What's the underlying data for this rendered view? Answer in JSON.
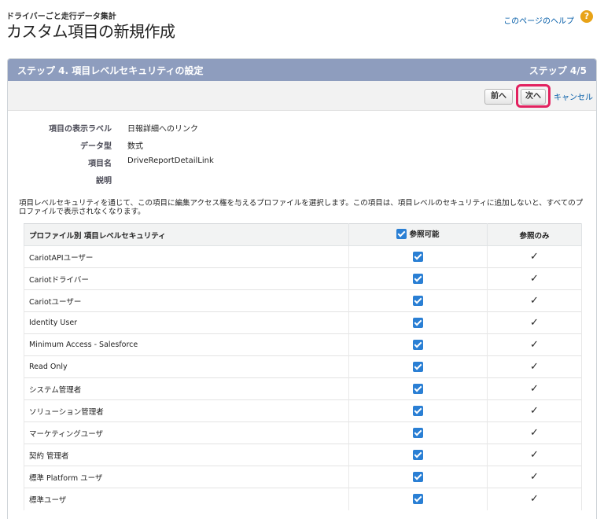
{
  "header": {
    "breadcrumb": "ドライバーごと走行データ集計",
    "title": "カスタム項目の新規作成",
    "help_link": "このページのヘルプ",
    "help_icon": "?"
  },
  "panel": {
    "title": "ステップ 4. 項目レベルセキュリティの設定",
    "step": "ステップ 4/5"
  },
  "buttons": {
    "prev": "前へ",
    "next": "次へ",
    "cancel": "キャンセル"
  },
  "details": [
    {
      "label": "項目の表示ラベル",
      "value": "日報詳細へのリンク"
    },
    {
      "label": "データ型",
      "value": "数式"
    },
    {
      "label": "項目名",
      "value": "DriveReportDetailLink"
    },
    {
      "label": "説明",
      "value": ""
    }
  ],
  "instructions": "項目レベルセキュリティを通じて、この項目に編集アクセス権を与えるプロファイルを選択します。この項目は、項目レベルのセキュリティに追加しないと、すべてのプロファイルで表示されなくなります。",
  "table": {
    "headers": {
      "profile": "プロファイル別 項目レベルセキュリティ",
      "visible": "参照可能",
      "readonly": "参照のみ"
    },
    "rows": [
      {
        "profile": "CariotAPIユーザー",
        "visible": true,
        "readonly": "✓"
      },
      {
        "profile": "Cariotドライバー",
        "visible": true,
        "readonly": "✓"
      },
      {
        "profile": "Cariotユーザー",
        "visible": true,
        "readonly": "✓"
      },
      {
        "profile": "Identity User",
        "visible": true,
        "readonly": "✓"
      },
      {
        "profile": "Minimum Access - Salesforce",
        "visible": true,
        "readonly": "✓"
      },
      {
        "profile": "Read Only",
        "visible": true,
        "readonly": "✓"
      },
      {
        "profile": "システム管理者",
        "visible": true,
        "readonly": "✓"
      },
      {
        "profile": "ソリューション管理者",
        "visible": true,
        "readonly": "✓"
      },
      {
        "profile": "マーケティングユーザ",
        "visible": true,
        "readonly": "✓"
      },
      {
        "profile": "契約 管理者",
        "visible": true,
        "readonly": "✓"
      },
      {
        "profile": "標準 Platform ユーザ",
        "visible": true,
        "readonly": "✓"
      },
      {
        "profile": "標準ユーザ",
        "visible": true,
        "readonly": "✓"
      }
    ]
  },
  "colors": {
    "panel_header": "#8e9dbe",
    "highlight": "#e2215f",
    "checkbox": "#2a7fd4",
    "link": "#015ba7"
  }
}
